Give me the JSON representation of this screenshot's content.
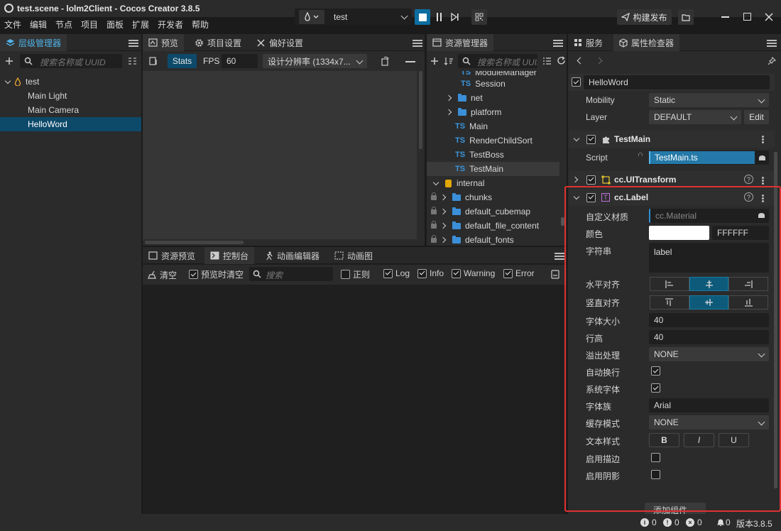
{
  "window": {
    "title": "test.scene - lolm2Client - Cocos Creator 3.8.5",
    "scene_select": "test",
    "publish_label": "构建发布"
  },
  "menu": [
    "文件",
    "编辑",
    "节点",
    "项目",
    "面板",
    "扩展",
    "开发者",
    "帮助"
  ],
  "hierarchy": {
    "tab": "层级管理器",
    "search_placeholder": "搜索名称或 UUID",
    "root": "test",
    "children": [
      "Main Light",
      "Main Camera",
      "HelloWord"
    ],
    "selected": "HelloWord"
  },
  "preview": {
    "tabs": [
      "预览",
      "项目设置",
      "偏好设置"
    ],
    "stats_label": "Stats",
    "fps_label": "FPS",
    "fps_value": "60",
    "resolution": "设计分辨率 (1334x7..."
  },
  "console": {
    "tabs": [
      "资源预览",
      "控制台",
      "动画编辑器",
      "动画图"
    ],
    "clear_label": "清空",
    "clear_on_preview": "预览时清空",
    "search_placeholder": "搜索",
    "regex_label": "正则",
    "filters": [
      "Log",
      "Info",
      "Warning",
      "Error"
    ]
  },
  "assets": {
    "tab": "资源管理器",
    "search_placeholder": "搜索名称或 UUID",
    "partial_top": "ModuleManager",
    "items": [
      {
        "kind": "ts",
        "label": "Session"
      },
      {
        "kind": "folder",
        "label": "net"
      },
      {
        "kind": "folder",
        "label": "platform"
      },
      {
        "kind": "ts",
        "label": "Main"
      },
      {
        "kind": "ts",
        "label": "RenderChildSort"
      },
      {
        "kind": "ts",
        "label": "TestBoss"
      },
      {
        "kind": "ts",
        "label": "TestMain"
      }
    ],
    "internal_label": "internal",
    "internal_items": [
      "chunks",
      "default_cubemap",
      "default_file_content",
      "default_fonts"
    ],
    "ts_badge": "TS"
  },
  "inspector": {
    "tabs": [
      "服务",
      "属性检查器"
    ],
    "node_name": "HelloWord",
    "mobility_label": "Mobility",
    "mobility_value": "Static",
    "layer_label": "Layer",
    "layer_value": "DEFAULT",
    "edit_label": "Edit",
    "testmain": {
      "title": "TestMain",
      "script_label": "Script",
      "script_value": "TestMain.ts"
    },
    "uitransform_title": "cc.UITransform",
    "label_comp": {
      "title": "cc.Label",
      "custom_material_label": "自定义材质",
      "custom_material_value": "cc.Material",
      "color_label": "颜色",
      "color_hex": "FFFFFF",
      "string_label": "字符串",
      "string_value": "label",
      "h_align_label": "水平对齐",
      "v_align_label": "竖直对齐",
      "font_size_label": "字体大小",
      "font_size_value": "40",
      "line_height_label": "行高",
      "line_height_value": "40",
      "overflow_label": "溢出处理",
      "overflow_value": "NONE",
      "wrap_label": "自动换行",
      "system_font_label": "系统字体",
      "font_family_label": "字体族",
      "font_family_value": "Arial",
      "cache_mode_label": "缓存模式",
      "cache_mode_value": "NONE",
      "text_style_label": "文本样式",
      "bold": "B",
      "italic": "I",
      "underline": "U",
      "outline_label": "启用描边",
      "shadow_label": "启用阴影"
    },
    "add_component_label": "添加组件"
  },
  "statusbar": {
    "info_count": "0",
    "warn_count": "0",
    "error_count": "0",
    "notif_count": "0",
    "version": "版本3.8.5"
  },
  "colors": {
    "accent": "#2d8fd6",
    "highlight_border": "#e03131",
    "selection": "#0d5a7a"
  }
}
